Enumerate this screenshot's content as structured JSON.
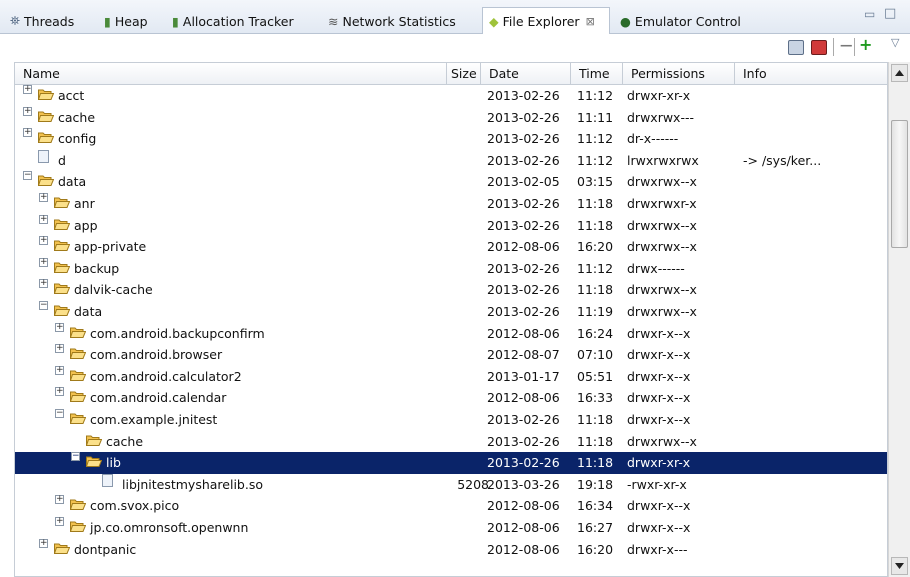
{
  "tabs": [
    {
      "label": "Threads",
      "icon": "threads-icon"
    },
    {
      "label": "Heap",
      "icon": "heap-icon"
    },
    {
      "label": "Allocation Tracker",
      "icon": "allocation-icon"
    },
    {
      "label": "Network Statistics",
      "icon": "network-icon"
    },
    {
      "label": "File Explorer",
      "icon": "android-icon",
      "close": "⊠"
    },
    {
      "label": "Emulator Control",
      "icon": "emulator-icon"
    }
  ],
  "window_controls": {
    "minimize": "▭",
    "maximize": "□"
  },
  "toolbar": {
    "pull_icon": "pull-file-icon",
    "push_icon": "push-file-icon",
    "delete_label": "—",
    "new_folder_label": "+",
    "menu_label": "▽"
  },
  "columns": [
    "Name",
    "Size",
    "Date",
    "Time",
    "Permissions",
    "Info"
  ],
  "rows": [
    {
      "name": "acct",
      "size": "",
      "date": "2013-02-26",
      "time": "11:12",
      "perm": "drwxr-xr-x",
      "info": "",
      "level": 0,
      "type": "folder",
      "toggle": "+"
    },
    {
      "name": "cache",
      "size": "",
      "date": "2013-02-26",
      "time": "11:11",
      "perm": "drwxrwx---",
      "info": "",
      "level": 0,
      "type": "folder",
      "toggle": "+"
    },
    {
      "name": "config",
      "size": "",
      "date": "2013-02-26",
      "time": "11:12",
      "perm": "dr-x------",
      "info": "",
      "level": 0,
      "type": "folder",
      "toggle": "+"
    },
    {
      "name": "d",
      "size": "",
      "date": "2013-02-26",
      "time": "11:12",
      "perm": "lrwxrwxrwx",
      "info": "-> /sys/ker...",
      "level": 0,
      "type": "file",
      "toggle": ""
    },
    {
      "name": "data",
      "size": "",
      "date": "2013-02-05",
      "time": "03:15",
      "perm": "drwxrwx--x",
      "info": "",
      "level": 0,
      "type": "folder",
      "toggle": "−"
    },
    {
      "name": "anr",
      "size": "",
      "date": "2013-02-26",
      "time": "11:18",
      "perm": "drwxrwxr-x",
      "info": "",
      "level": 1,
      "type": "folder",
      "toggle": "+"
    },
    {
      "name": "app",
      "size": "",
      "date": "2013-02-26",
      "time": "11:18",
      "perm": "drwxrwx--x",
      "info": "",
      "level": 1,
      "type": "folder",
      "toggle": "+"
    },
    {
      "name": "app-private",
      "size": "",
      "date": "2012-08-06",
      "time": "16:20",
      "perm": "drwxrwx--x",
      "info": "",
      "level": 1,
      "type": "folder",
      "toggle": "+"
    },
    {
      "name": "backup",
      "size": "",
      "date": "2013-02-26",
      "time": "11:12",
      "perm": "drwx------",
      "info": "",
      "level": 1,
      "type": "folder",
      "toggle": "+"
    },
    {
      "name": "dalvik-cache",
      "size": "",
      "date": "2013-02-26",
      "time": "11:18",
      "perm": "drwxrwx--x",
      "info": "",
      "level": 1,
      "type": "folder",
      "toggle": "+"
    },
    {
      "name": "data",
      "size": "",
      "date": "2013-02-26",
      "time": "11:19",
      "perm": "drwxrwx--x",
      "info": "",
      "level": 1,
      "type": "folder",
      "toggle": "−"
    },
    {
      "name": "com.android.backupconfirm",
      "size": "",
      "date": "2012-08-06",
      "time": "16:24",
      "perm": "drwxr-x--x",
      "info": "",
      "level": 2,
      "type": "folder",
      "toggle": "+"
    },
    {
      "name": "com.android.browser",
      "size": "",
      "date": "2012-08-07",
      "time": "07:10",
      "perm": "drwxr-x--x",
      "info": "",
      "level": 2,
      "type": "folder",
      "toggle": "+"
    },
    {
      "name": "com.android.calculator2",
      "size": "",
      "date": "2013-01-17",
      "time": "05:51",
      "perm": "drwxr-x--x",
      "info": "",
      "level": 2,
      "type": "folder",
      "toggle": "+"
    },
    {
      "name": "com.android.calendar",
      "size": "",
      "date": "2012-08-06",
      "time": "16:33",
      "perm": "drwxr-x--x",
      "info": "",
      "level": 2,
      "type": "folder",
      "toggle": "+"
    },
    {
      "name": "com.example.jnitest",
      "size": "",
      "date": "2013-02-26",
      "time": "11:18",
      "perm": "drwxr-x--x",
      "info": "",
      "level": 2,
      "type": "folder",
      "toggle": "−"
    },
    {
      "name": "cache",
      "size": "",
      "date": "2013-02-26",
      "time": "11:18",
      "perm": "drwxrwx--x",
      "info": "",
      "level": 3,
      "type": "folder",
      "toggle": ""
    },
    {
      "name": "lib",
      "size": "",
      "date": "2013-02-26",
      "time": "11:18",
      "perm": "drwxr-xr-x",
      "info": "",
      "level": 3,
      "type": "folder",
      "toggle": "−",
      "selected": true
    },
    {
      "name": "libjnitestmysharelib.so",
      "size": "5208",
      "date": "2013-03-26",
      "time": "19:18",
      "perm": "-rwxr-xr-x",
      "info": "",
      "level": 4,
      "type": "file",
      "toggle": ""
    },
    {
      "name": "com.svox.pico",
      "size": "",
      "date": "2012-08-06",
      "time": "16:34",
      "perm": "drwxr-x--x",
      "info": "",
      "level": 2,
      "type": "folder",
      "toggle": "+"
    },
    {
      "name": "jp.co.omronsoft.openwnn",
      "size": "",
      "date": "2012-08-06",
      "time": "16:27",
      "perm": "drwxr-x--x",
      "info": "",
      "level": 2,
      "type": "folder",
      "toggle": "+"
    },
    {
      "name": "dontpanic",
      "size": "",
      "date": "2012-08-06",
      "time": "16:20",
      "perm": "drwxr-x---",
      "info": "",
      "level": 1,
      "type": "folder",
      "toggle": "+"
    }
  ],
  "colors": {
    "selection": "#0a2469",
    "folder": "#f2c14e",
    "android": "#9fc33b"
  }
}
